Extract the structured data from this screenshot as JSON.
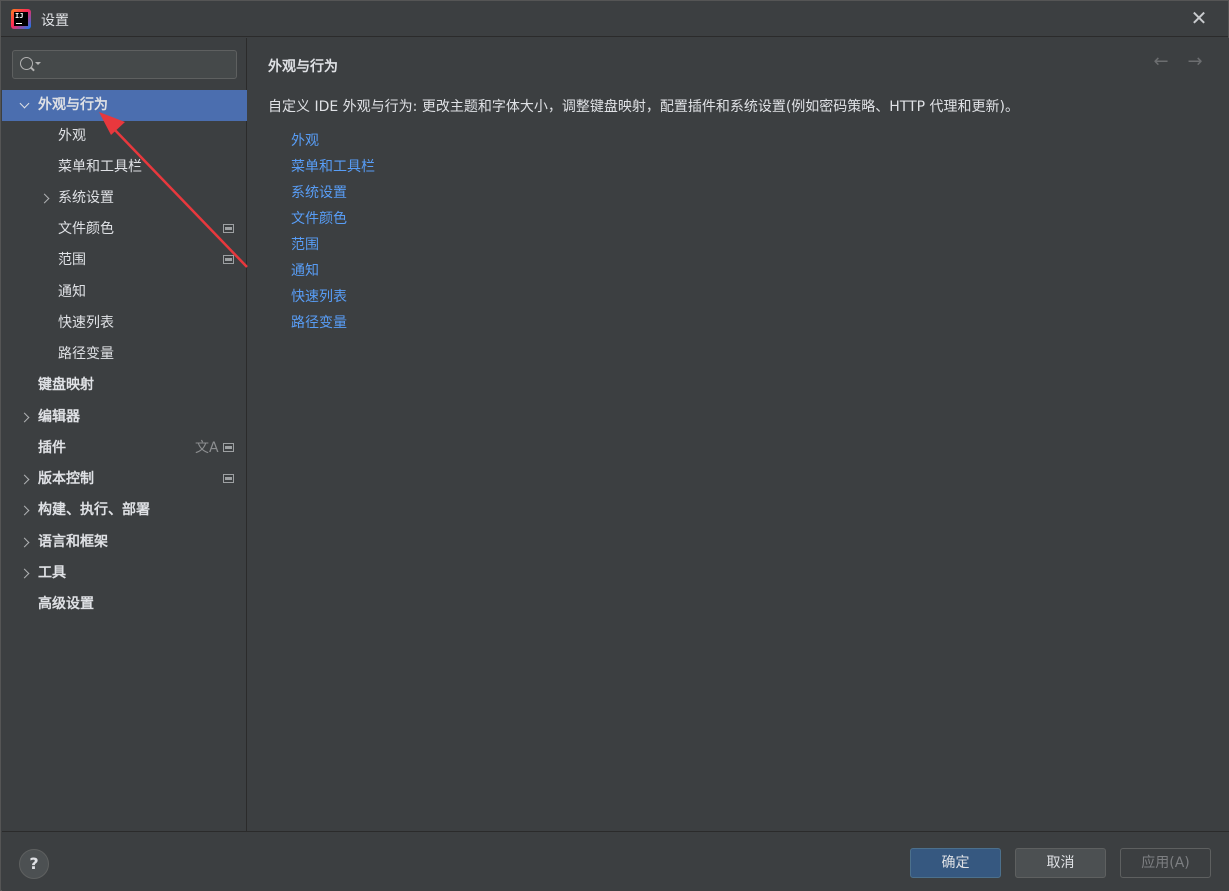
{
  "window": {
    "title": "设置",
    "icon_name": "intellij-idea-icon",
    "close_icon": "close-icon"
  },
  "search": {
    "value": "",
    "placeholder": ""
  },
  "tree": [
    {
      "label": "外观与行为",
      "level": 0,
      "expanded": true,
      "selected": true
    },
    {
      "label": "外观",
      "level": 1
    },
    {
      "label": "菜单和工具栏",
      "level": 1
    },
    {
      "label": "系统设置",
      "level": 1,
      "collapsible": true
    },
    {
      "label": "文件颜色",
      "level": 1,
      "project_icon": true
    },
    {
      "label": "范围",
      "level": 1,
      "project_icon": true
    },
    {
      "label": "通知",
      "level": 1
    },
    {
      "label": "快速列表",
      "level": 1
    },
    {
      "label": "路径变量",
      "level": 1
    },
    {
      "label": "键盘映射",
      "level": 0
    },
    {
      "label": "编辑器",
      "level": 0,
      "collapsible": true
    },
    {
      "label": "插件",
      "level": 0,
      "translate_icon": true,
      "project_icon": true
    },
    {
      "label": "版本控制",
      "level": 0,
      "collapsible": true,
      "project_icon": true
    },
    {
      "label": "构建、执行、部署",
      "level": 0,
      "collapsible": true
    },
    {
      "label": "语言和框架",
      "level": 0,
      "collapsible": true
    },
    {
      "label": "工具",
      "level": 0,
      "collapsible": true
    },
    {
      "label": "高级设置",
      "level": 0
    }
  ],
  "content": {
    "title": "外观与行为",
    "description": "自定义 IDE 外观与行为: 更改主题和字体大小，调整键盘映射，配置插件和系统设置(例如密码策略、HTTP 代理和更新)。",
    "links": [
      "外观",
      "菜单和工具栏",
      "系统设置",
      "文件颜色",
      "范围",
      "通知",
      "快速列表",
      "路径变量"
    ],
    "nav_back_icon": "arrow-left-icon",
    "nav_forward_icon": "arrow-right-icon"
  },
  "footer": {
    "help_label": "?",
    "ok_label": "确定",
    "cancel_label": "取消",
    "apply_label": "应用(A)"
  },
  "colors": {
    "selection": "#4b6eaf",
    "link": "#589df6",
    "annotation_arrow": "#e8383d"
  }
}
